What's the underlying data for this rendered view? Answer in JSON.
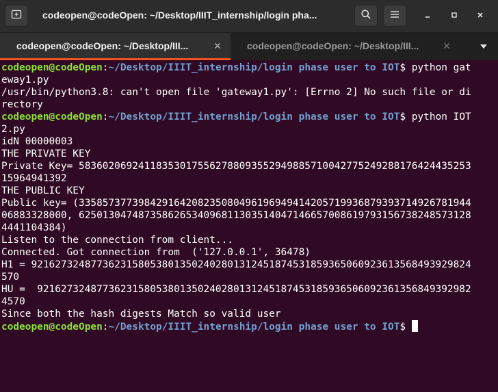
{
  "header": {
    "title": "codeopen@codeOpen: ~/Desktop/IIIT_internship/login pha...",
    "new_tab_icon": "new-tab-icon",
    "search_icon": "search-icon",
    "menu_icon": "hamburger-menu-icon",
    "minimize_icon": "minimize-icon",
    "maximize_icon": "maximize-icon",
    "close_icon": "close-icon"
  },
  "tabs": [
    {
      "label": "codeopen@codeOpen: ~/Desktop/III...",
      "active": true
    },
    {
      "label": "codeopen@codeOpen: ~/Desktop/III...",
      "active": false
    }
  ],
  "terminal": {
    "prompt_user": "codeopen@codeOpen",
    "prompt_sep": ":",
    "prompt_path": "~/Desktop/IIIT_internship/login phase user to IOT",
    "prompt_dollar": "$",
    "lines": [
      {
        "kind": "prompt",
        "cmd": " python gat"
      },
      {
        "kind": "text",
        "text": "eway1.py"
      },
      {
        "kind": "text",
        "text": "/usr/bin/python3.8: can't open file 'gateway1.py': [Errno 2] No such file or di"
      },
      {
        "kind": "text",
        "text": "rectory"
      },
      {
        "kind": "prompt",
        "cmd": " python IOT"
      },
      {
        "kind": "text",
        "text": "2.py"
      },
      {
        "kind": "text",
        "text": "idN 00000003"
      },
      {
        "kind": "text",
        "text": "THE PRIVATE KEY"
      },
      {
        "kind": "text",
        "text": "Private Key= 5836020692411835301755627880935529498857100427752492881764244352​53"
      },
      {
        "kind": "text",
        "text": "15964941392"
      },
      {
        "kind": "text",
        "text": "THE PUBLIC KEY"
      },
      {
        "kind": "text",
        "text": "Public key= (33585737739842916420823508049619694941420571993687939371492678​1944"
      },
      {
        "kind": "text",
        "text": "06883328000, 62501304748735862653409681130351404714665700861979315673824857​3128"
      },
      {
        "kind": "text",
        "text": "4441104384)"
      },
      {
        "kind": "text",
        "text": "Listen to the connection from client..."
      },
      {
        "kind": "text",
        "text": "Connected. Got connection from  ('127.0.0.1', 36478)"
      },
      {
        "kind": "text",
        "text": "H1 = 92162732487736231580538013502402801312451874531859365060923613568493929824"
      },
      {
        "kind": "text",
        "text": "570"
      },
      {
        "kind": "text",
        "text": "HU =  9216273248773623158053801350240280131245187453185936506092361356849392982"
      },
      {
        "kind": "text",
        "text": "4570"
      },
      {
        "kind": "text",
        "text": "Since both the hash digests Match so valid user"
      },
      {
        "kind": "prompt_cursor",
        "cmd": " "
      }
    ]
  },
  "colors": {
    "terminal_bg": "#300a24",
    "prompt_user": "#8ae234",
    "prompt_path": "#729fcf",
    "text": "#ffffff",
    "tab_accent": "#e95420"
  }
}
